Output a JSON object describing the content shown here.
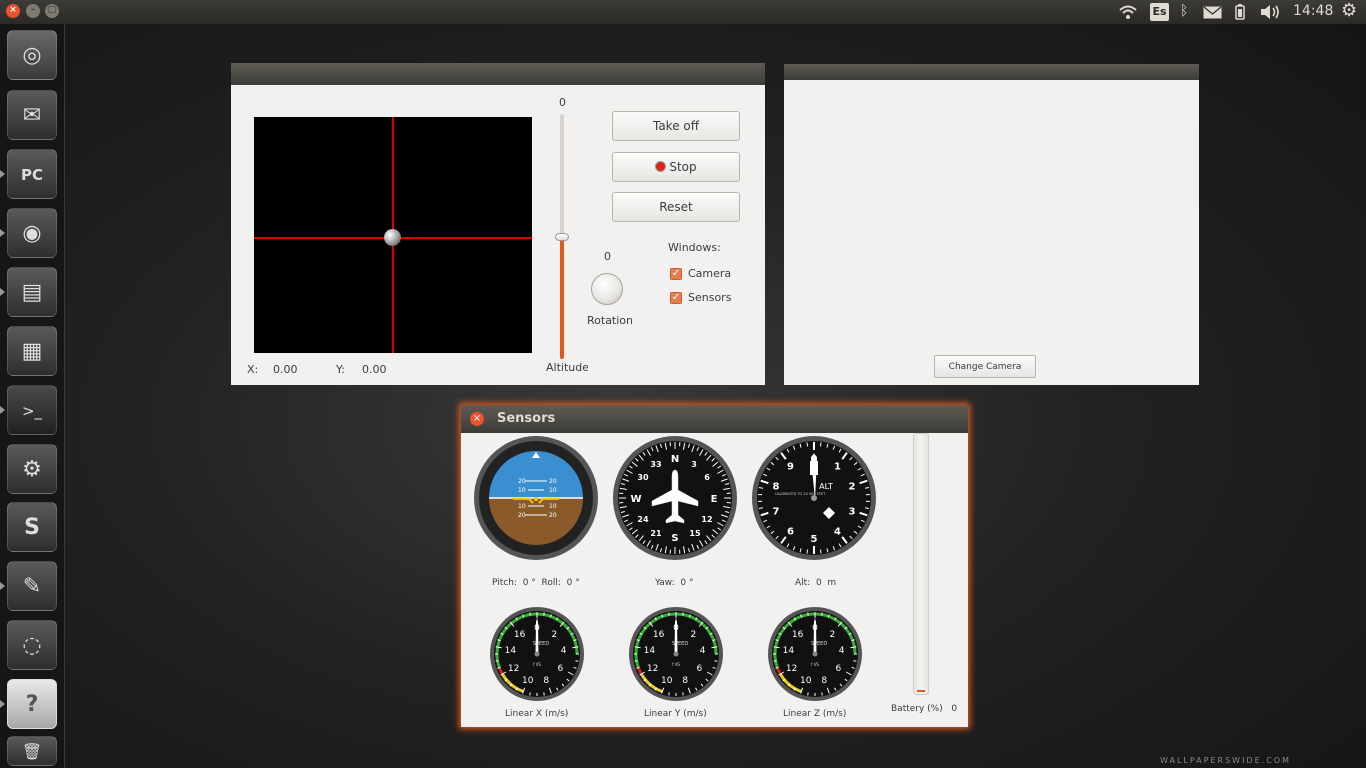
{
  "top_panel": {
    "keyboard_layout": "Es",
    "clock": "14:48",
    "icons": [
      "wifi-icon",
      "keyboard-layout-indicator",
      "bluetooth-icon",
      "mail-icon",
      "battery-icon",
      "volume-icon",
      "settings-gear-icon"
    ]
  },
  "launcher": {
    "items": [
      {
        "name": "ubuntu-dash-icon",
        "glyph": "◎"
      },
      {
        "name": "thunderbird-icon",
        "glyph": "✉"
      },
      {
        "name": "pycharm-icon",
        "glyph": "PC"
      },
      {
        "name": "firefox-icon",
        "glyph": "◉"
      },
      {
        "name": "files-icon",
        "glyph": "▤"
      },
      {
        "name": "workspace-switcher-icon",
        "glyph": "▦"
      },
      {
        "name": "terminal-icon",
        "glyph": ">_"
      },
      {
        "name": "system-settings-icon",
        "glyph": "⚙"
      },
      {
        "name": "sublime-text-icon",
        "glyph": "S"
      },
      {
        "name": "text-editor-icon",
        "glyph": "✎"
      },
      {
        "name": "screenshot-tool-icon",
        "glyph": "◌"
      },
      {
        "name": "help-icon",
        "glyph": "?"
      },
      {
        "name": "trash-icon",
        "glyph": "🗑"
      }
    ]
  },
  "teleop": {
    "x_label": "X:",
    "x_value": "0.00",
    "y_label": "Y:",
    "y_value": "0.00",
    "altitude_value": "0",
    "altitude_label": "Altitude",
    "rotation_value": "0",
    "rotation_label": "Rotation",
    "takeoff_label": "Take off",
    "stop_label": "Stop",
    "reset_label": "Reset",
    "windows_label": "Windows:",
    "camera_checkbox_label": "Camera",
    "sensors_checkbox_label": "Sensors",
    "altitude_slider_level": 0.5,
    "accent_color": "#e05a1f"
  },
  "camera_window": {
    "change_camera_label": "Change Camera"
  },
  "sensors_window": {
    "title": "Sensors",
    "pitch_label": "Pitch:",
    "pitch_value": "0",
    "roll_label": "Roll:",
    "roll_value": "0",
    "degree_unit": "°",
    "yaw_label": "Yaw:",
    "yaw_value": "0",
    "alt_label": "Alt:",
    "alt_value": "0",
    "alt_unit": "m",
    "linear_x_label": "Linear X (m/s)",
    "linear_y_label": "Linear Y (m/s)",
    "linear_z_label": "Linear Z (m/s)",
    "battery_label": "Battery (%)",
    "battery_value": "0",
    "attitude_pitch_marks": [
      "20",
      "10",
      "10",
      "20"
    ],
    "heading_marks": [
      "33",
      "N",
      "3",
      "6",
      "E",
      "12",
      "15",
      "S",
      "21",
      "24",
      "W",
      "30"
    ],
    "altimeter_marks": [
      "0",
      "1",
      "2",
      "3",
      "4",
      "5",
      "6",
      "7",
      "8",
      "9"
    ],
    "altimeter_text": "ALT",
    "altimeter_subtext": "CALIBRATED TO 20 000 FEET",
    "speed_marks": [
      "0",
      "2",
      "4",
      "6",
      "8",
      "10",
      "12",
      "14",
      "16"
    ],
    "speed_text": "SPEED",
    "speed_unit_text": "f VS"
  },
  "watermark": "WALLPAPERSWIDE.COM"
}
